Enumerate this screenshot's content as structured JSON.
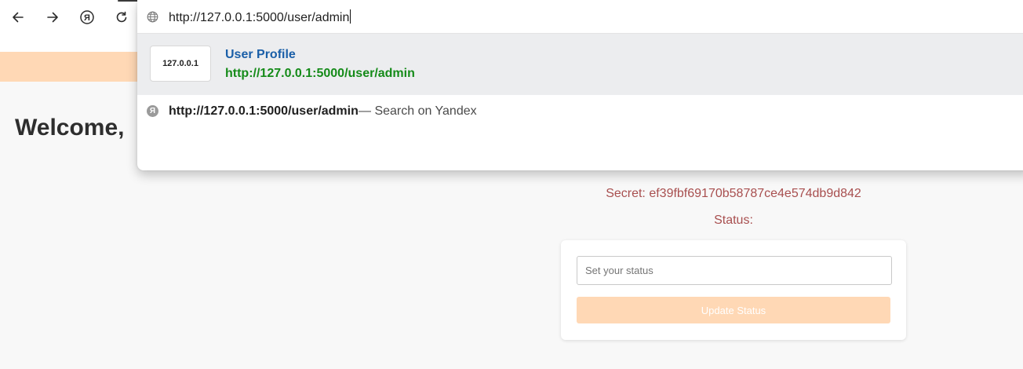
{
  "browser": {
    "nav_icons": [
      "back-arrow-icon",
      "forward-arrow-icon",
      "yandex-icon",
      "reload-icon"
    ]
  },
  "omnibox": {
    "url_value": "http://127.0.0.1:5000/user/admin",
    "suggestions": [
      {
        "site_label": "127.0.0.1",
        "title": "User Profile",
        "url": "http://127.0.0.1:5000/user/admin"
      }
    ],
    "search_suggestion": {
      "query": "http://127.0.0.1:5000/user/admin",
      "suffix": "— Search on Yandex",
      "icon_letter": "Я"
    }
  },
  "page": {
    "welcome": "Welcome,",
    "secret": "Secret: ef39fbf69170b58787ce4e574db9d842",
    "status_label": "Status:",
    "status_placeholder": "Set your status",
    "update_button": "Update Status"
  },
  "colors": {
    "accent_peach": "#ffd8b5",
    "secret_text": "#a84f4f",
    "link_title": "#1a5fa8",
    "link_url": "#158b19"
  }
}
